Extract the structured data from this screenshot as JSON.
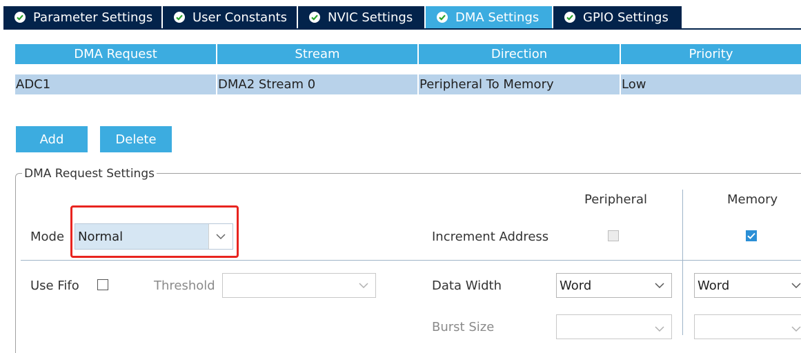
{
  "tabs": [
    {
      "label": "Parameter Settings",
      "active": false
    },
    {
      "label": "User Constants",
      "active": false
    },
    {
      "label": "NVIC Settings",
      "active": false
    },
    {
      "label": "DMA Settings",
      "active": true
    },
    {
      "label": "GPIO Settings",
      "active": false
    }
  ],
  "table": {
    "headers": [
      "DMA Request",
      "Stream",
      "Direction",
      "Priority"
    ],
    "rows": [
      [
        "ADC1",
        "DMA2 Stream 0",
        "Peripheral To Memory",
        "Low"
      ]
    ]
  },
  "buttons": {
    "add": "Add",
    "delete": "Delete"
  },
  "settings": {
    "legend": "DMA Request Settings",
    "mode_label": "Mode",
    "mode_value": "Normal",
    "peripheral_header": "Peripheral",
    "memory_header": "Memory",
    "increment_label": "Increment Address",
    "increment_peripheral": false,
    "increment_memory": true,
    "use_fifo_label": "Use Fifo",
    "use_fifo": false,
    "threshold_label": "Threshold",
    "threshold_value": "",
    "data_width_label": "Data Width",
    "data_width_peripheral": "Word",
    "data_width_memory": "Word",
    "burst_size_label": "Burst Size",
    "burst_peripheral": "",
    "burst_memory": ""
  },
  "colors": {
    "tab_bg": "#03234b",
    "tab_active": "#3cace0",
    "row_bg": "#b8d2ea",
    "highlight": "#e8241f"
  }
}
